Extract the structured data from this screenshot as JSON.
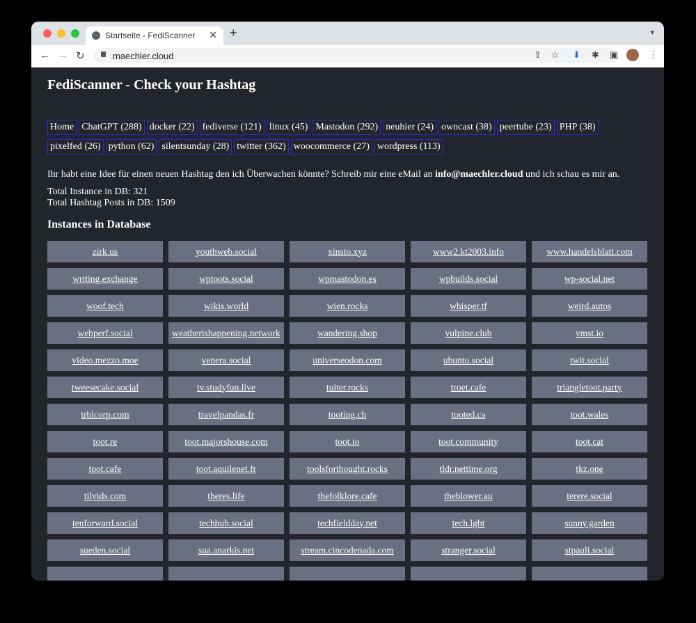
{
  "browser": {
    "tab_title": "Startseite - FediScanner",
    "url": "maechler.cloud"
  },
  "page": {
    "title": "FediScanner - Check your Hashtag",
    "nav": [
      "Home",
      "ChatGPT (288)",
      "docker (22)",
      "fediverse (121)",
      "linux (45)",
      "Mastodon (292)",
      "neuhier (24)",
      "owncast (38)",
      "peertube (23)",
      "PHP (38)",
      "pixelfed (26)",
      "python (62)",
      "silentsunday (28)",
      "twitter (362)",
      "woocommerce (27)",
      "wordpress (113)"
    ],
    "idea_prefix": "Ihr habt eine Idee für einen neuen Hashtag den ich Überwachen könnte? Schreib mir eine eMail an ",
    "idea_email": "info@maechler.cloud",
    "idea_suffix": " und ich schau es mir an.",
    "stats_instances": "Total Instance in DB: 321",
    "stats_posts": "Total Hashtag Posts in DB: 1509",
    "instances_heading": "Instances in Database",
    "instances": [
      "zirk.us",
      "youthweb.social",
      "xinsto.xyz",
      "www2.kt2003.info",
      "www.handelsblatt.com",
      "writing.exchange",
      "wptoots.social",
      "wpmastodon.es",
      "wpbuilds.social",
      "wp-social.net",
      "woof.tech",
      "wikis.world",
      "wien.rocks",
      "whisper.tf",
      "weird.autos",
      "webperf.social",
      "weatherishappening.network",
      "wandering.shop",
      "vulpine.club",
      "vmst.io",
      "video.mezzo.moe",
      "venera.social",
      "universeodon.com",
      "ubuntu.social",
      "twit.social",
      "tweesecake.social",
      "tv.studyfun.live",
      "tuiter.rocks",
      "troet.cafe",
      "triangletoot.party",
      "trblcorp.com",
      "travelpandas.fr",
      "tooting.ch",
      "tooted.ca",
      "toot.wales",
      "toot.re",
      "toot.majorshouse.com",
      "toot.io",
      "toot.community",
      "toot.cat",
      "toot.cafe",
      "toot.aquilenet.fr",
      "toolsforthought.rocks",
      "tldr.nettime.org",
      "tkz.one",
      "tilvids.com",
      "theres.life",
      "thefolklore.cafe",
      "theblower.au",
      "terere.social",
      "tenforward.social",
      "techhub.social",
      "techfieldday.net",
      "tech.lgbt",
      "sunny.garden",
      "sueden.social",
      "sua.anarkis.net",
      "stream.cincodenada.com",
      "stranger.social",
      "stpauli.social"
    ],
    "partial_row_count": 5
  },
  "colors": {
    "page_bg": "#22252b",
    "cell_bg": "#6a7081",
    "nav_border": "#2c2ccf"
  }
}
